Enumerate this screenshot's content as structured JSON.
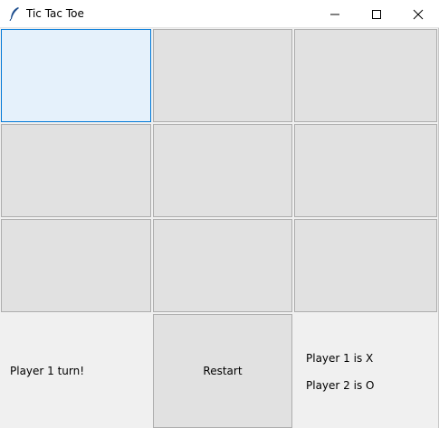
{
  "window": {
    "title": "Tic Tac Toe",
    "icon": "feather-icon",
    "controls": [
      "minimize-icon",
      "maximize-icon",
      "close-icon"
    ]
  },
  "board": {
    "cells": [
      "",
      "",
      "",
      "",
      "",
      "",
      "",
      "",
      ""
    ],
    "focused_cell": 0
  },
  "status": {
    "turn_text": "Player 1 turn!"
  },
  "controls": {
    "restart_label": "Restart"
  },
  "info": {
    "player1": "Player 1 is X",
    "player2": "Player 2 is O"
  },
  "colors": {
    "cell_bg": "#e1e1e1",
    "focus_bg": "#e5f1fb",
    "focus_border": "#0078d7",
    "window_bg": "#f0f0f0"
  }
}
